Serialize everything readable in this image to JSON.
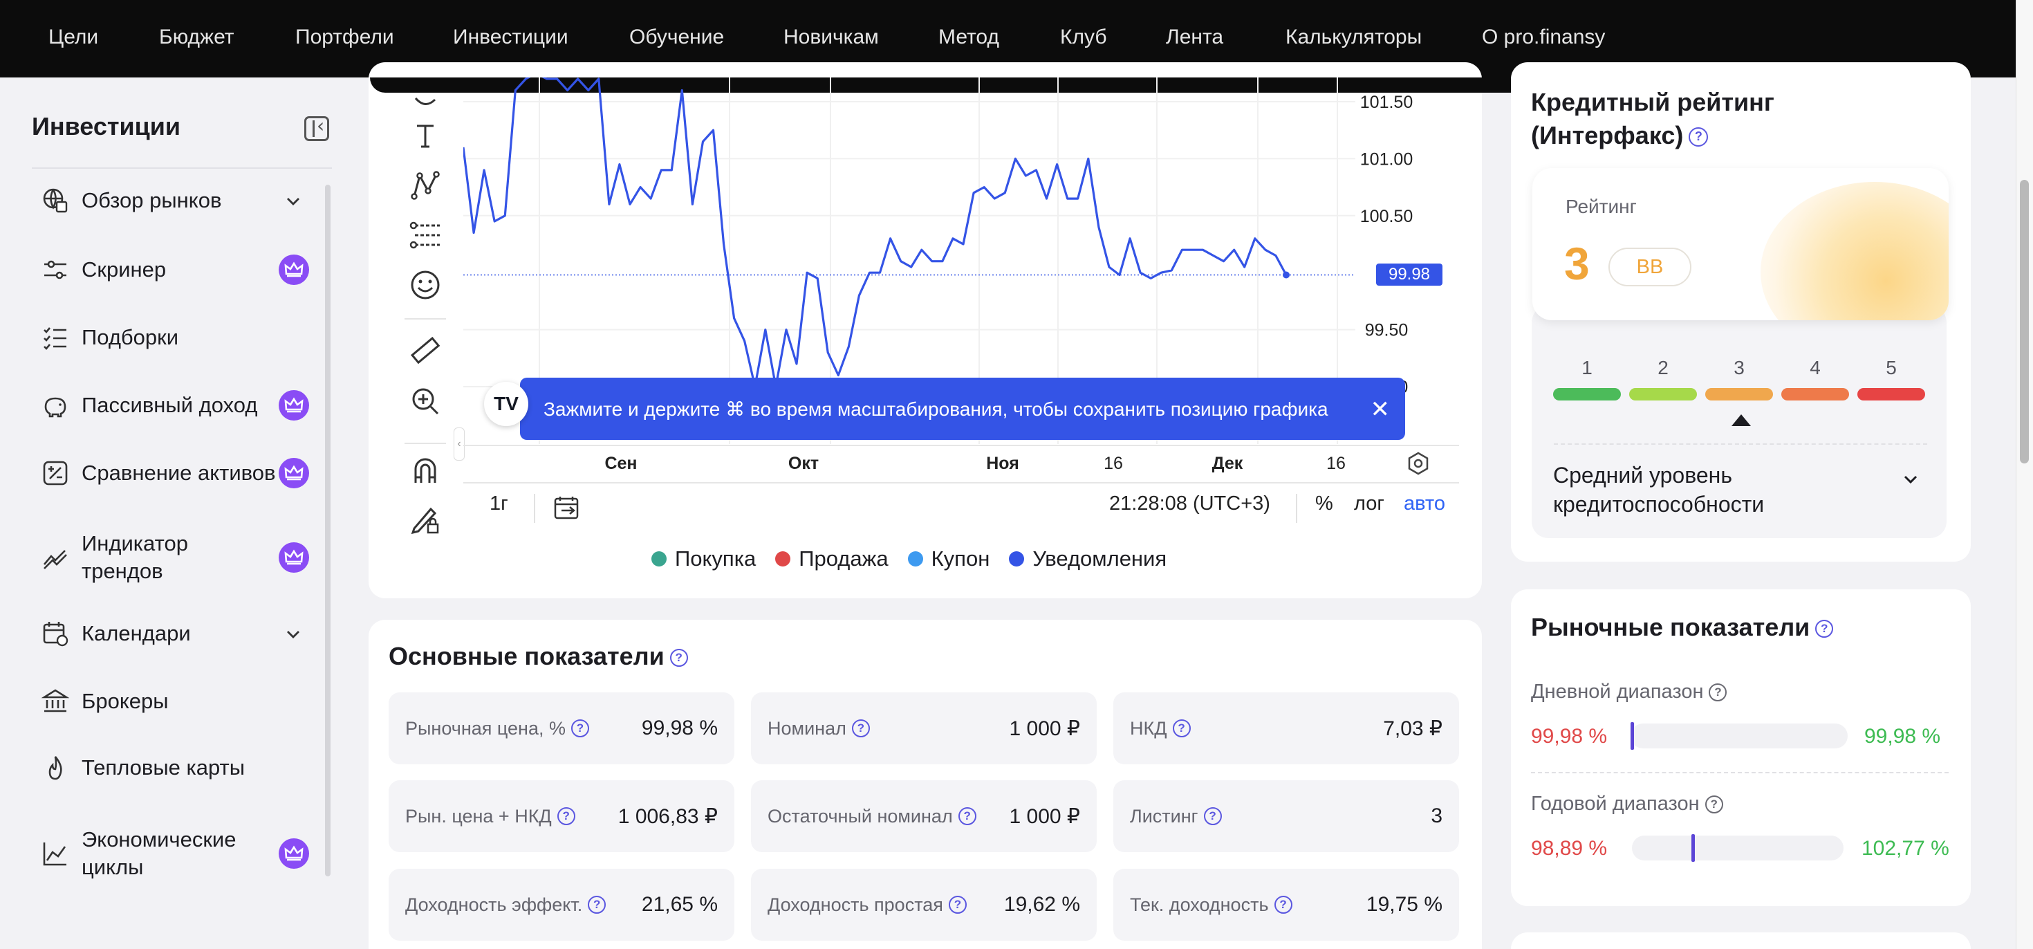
{
  "topnav": {
    "items": [
      "Цели",
      "Бюджет",
      "Портфели",
      "Инвестиции",
      "Обучение",
      "Новичкам",
      "Метод",
      "Клуб",
      "Лента",
      "Калькуляторы",
      "О pro.finansy"
    ]
  },
  "sidebar": {
    "title": "Инвестиции",
    "items": [
      {
        "label": "Обзор рынков",
        "icon": "globe-chart-icon",
        "chevron": true,
        "premium": false
      },
      {
        "label": "Скринер",
        "icon": "sliders-icon",
        "chevron": false,
        "premium": true
      },
      {
        "label": "Подборки",
        "icon": "checklist-icon",
        "chevron": false,
        "premium": false
      },
      {
        "label": "Пассивный доход",
        "icon": "piggy-bank-icon",
        "chevron": false,
        "premium": true
      },
      {
        "label": "Сравнение активов",
        "icon": "compare-icon",
        "chevron": false,
        "premium": true
      },
      {
        "label": "Индикатор трендов",
        "icon": "trend-icon",
        "chevron": false,
        "premium": true
      },
      {
        "label": "Календари",
        "icon": "calendar-icon",
        "chevron": true,
        "premium": false
      },
      {
        "label": "Брокеры",
        "icon": "bank-icon",
        "chevron": false,
        "premium": false
      },
      {
        "label": "Тепловые карты",
        "icon": "flame-icon",
        "chevron": false,
        "premium": false
      },
      {
        "label": "Экономические циклы",
        "icon": "line-chart-icon",
        "chevron": false,
        "premium": true
      }
    ]
  },
  "chart": {
    "y_ticks": [
      "101.50",
      "101.00",
      "100.50",
      "99.50",
      "99.00"
    ],
    "x_ticks": [
      "Сен",
      "Окт",
      "Ноя",
      "16",
      "Дек",
      "16"
    ],
    "last_price": "99.98",
    "banner": "Зажмите и держите ⌘ во время масштабирования, чтобы сохранить позицию графика",
    "tv_logo": "TV",
    "period": "1г",
    "time": "21:28:08 (UTC+3)",
    "percent": "%",
    "log": "лог",
    "auto": "авто",
    "legend": [
      {
        "label": "Покупка",
        "color": "#3aa58f"
      },
      {
        "label": "Продажа",
        "color": "#e04848"
      },
      {
        "label": "Купон",
        "color": "#3d9af0"
      },
      {
        "label": "Уведомления",
        "color": "#3454e6"
      }
    ]
  },
  "chart_data": {
    "type": "line",
    "series": [
      {
        "values": [
          101.1,
          100.35,
          100.9,
          100.45,
          100.5,
          101.6,
          101.7,
          101.75,
          101.7,
          101.7,
          101.6,
          101.7,
          101.6,
          101.7,
          100.6,
          100.95,
          100.6,
          100.75,
          100.65,
          100.9,
          100.9,
          101.6,
          100.6,
          101.15,
          101.25,
          100.25,
          99.6,
          99.4,
          99.0,
          99.5,
          99.0,
          99.5,
          99.2,
          100.0,
          99.95,
          99.3,
          99.1,
          99.35,
          99.8,
          100.0,
          100.0,
          100.3,
          100.1,
          100.05,
          100.2,
          100.1,
          100.1,
          100.3,
          100.25,
          100.7,
          100.75,
          100.65,
          100.7,
          101.0,
          100.85,
          100.9,
          100.65,
          100.95,
          100.65,
          100.65,
          101.0,
          100.4,
          100.05,
          99.98,
          100.3,
          100.0,
          99.95,
          100.0,
          100.02,
          100.2,
          100.2,
          100.2,
          100.15,
          100.1,
          100.2,
          100.05,
          100.3,
          100.2,
          100.15,
          99.98
        ]
      }
    ],
    "x_ticks": [
      "Сен",
      "Окт",
      "Ноя",
      "16",
      "Дек",
      "16"
    ],
    "y_ticks": [
      "101.50",
      "101.00",
      "100.50",
      "99.50",
      "99.00"
    ],
    "y_range": [
      98.9,
      101.75
    ],
    "color": "#3454e6",
    "last_value": 99.98
  },
  "main": {
    "title": "Основные показатели",
    "rows": [
      [
        {
          "label": "Рыночная цена, %",
          "value": "99,98 %"
        },
        {
          "label": "Номинал",
          "value": "1 000 ₽"
        },
        {
          "label": "НКД",
          "value": "7,03 ₽"
        }
      ],
      [
        {
          "label": "Рын. цена + НКД",
          "value": "1 006,83 ₽"
        },
        {
          "label": "Остаточный номинал",
          "value": "1 000 ₽"
        },
        {
          "label": "Листинг",
          "value": "3"
        }
      ],
      [
        {
          "label": "Доходность эффект.",
          "value": "21,65 %"
        },
        {
          "label": "Доходность простая",
          "value": "19,62 %"
        },
        {
          "label": "Тек. доходность",
          "value": "19,75 %"
        }
      ]
    ]
  },
  "rating": {
    "title_line1": "Кредитный рейтинг",
    "title_line2": "(Интерфакс)",
    "label": "Рейтинг",
    "score": "3",
    "grade": "BB",
    "scale": [
      {
        "num": "1",
        "color": "#4cbb5a"
      },
      {
        "num": "2",
        "color": "#a6d94a"
      },
      {
        "num": "3",
        "color": "#f0a74d"
      },
      {
        "num": "4",
        "color": "#ee7a4a"
      },
      {
        "num": "5",
        "color": "#e74444"
      }
    ],
    "description_line1": "Средний уровень",
    "description_line2": "кредитоспособности"
  },
  "market": {
    "title": "Рыночные показатели",
    "daily": {
      "label": "Дневной диапазон",
      "low": "99,98 %",
      "high": "99,98 %",
      "position": 0.0
    },
    "yearly": {
      "label": "Годовой диапазон",
      "low": "98,89 %",
      "high": "102,77 %",
      "position": 0.28
    }
  }
}
